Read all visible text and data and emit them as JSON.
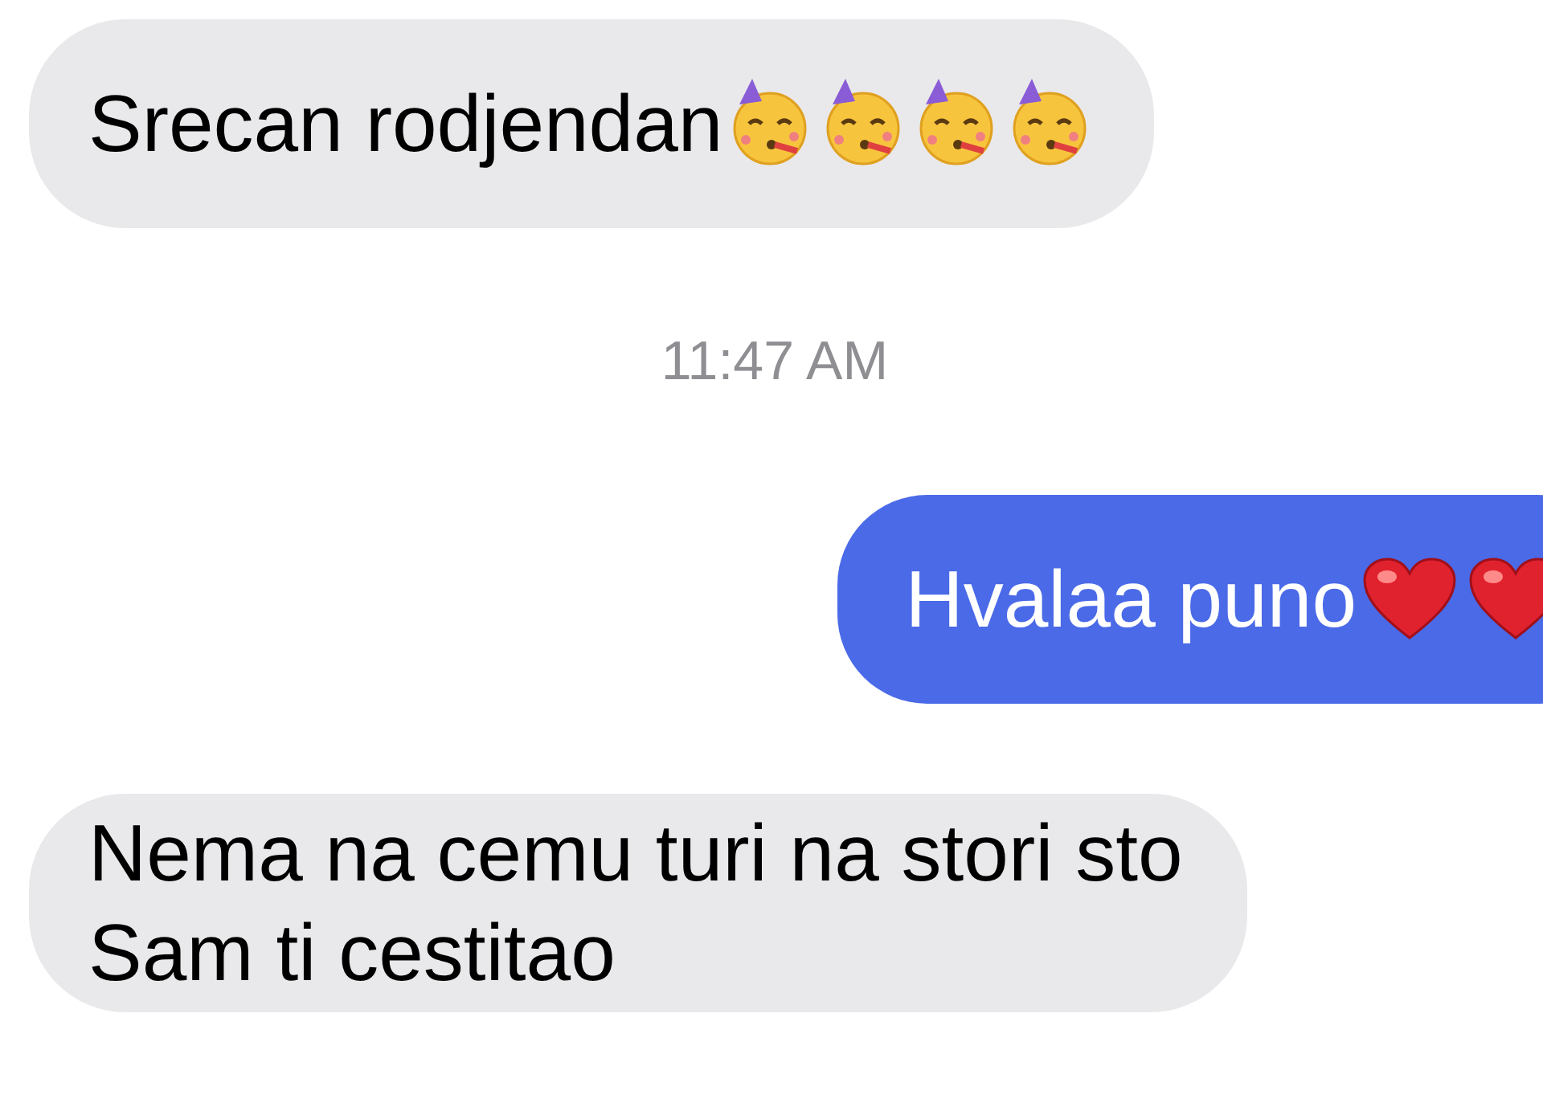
{
  "messages": [
    {
      "kind": "received",
      "lines": [
        "Srecan rodjendan"
      ],
      "emojis": [
        {
          "kind": "partying_face"
        },
        {
          "kind": "partying_face"
        },
        {
          "kind": "partying_face"
        },
        {
          "kind": "partying_face"
        }
      ]
    },
    {
      "kind": "timestamp",
      "lines": [
        "11:47 AM"
      ]
    },
    {
      "kind": "sent",
      "lines": [
        "Hvalaa puno"
      ],
      "emojis": [
        {
          "kind": "heart"
        },
        {
          "kind": "heart"
        }
      ]
    },
    {
      "kind": "received",
      "lines": [
        "Nema na cemu turi na stori sto",
        "Sam ti cestitao"
      ]
    }
  ]
}
